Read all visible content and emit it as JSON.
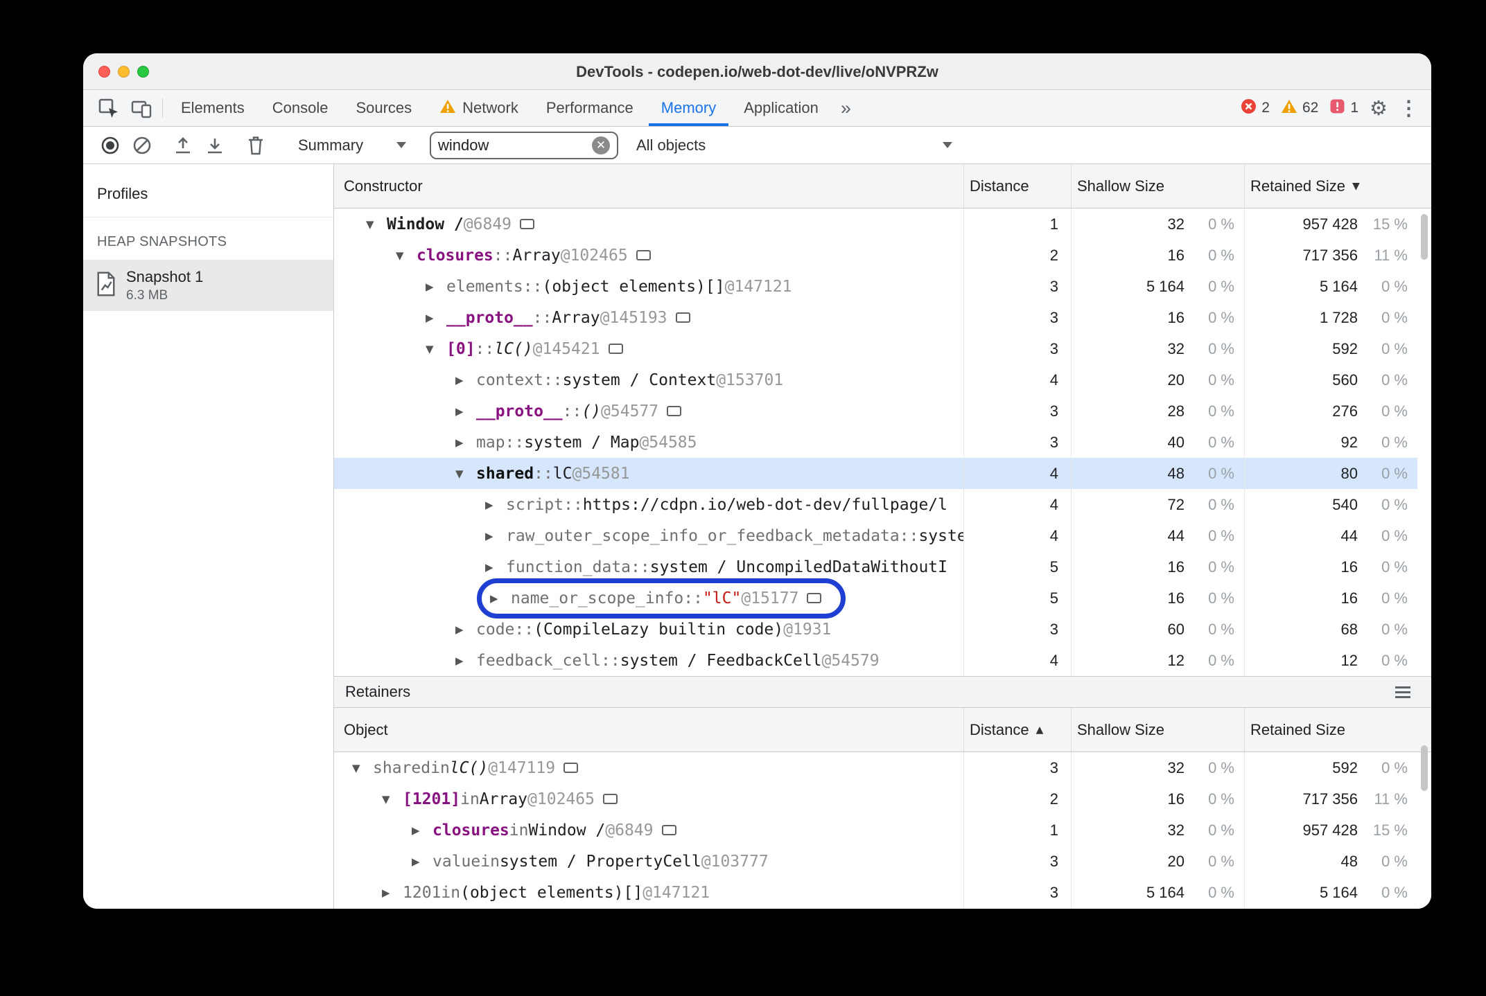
{
  "window": {
    "title": "DevTools - codepen.io/web-dot-dev/live/oNVPRZw"
  },
  "icons": {
    "gear": "⚙",
    "kebab": "⋮",
    "more_tabs": "»"
  },
  "tab_bar": {
    "tabs": [
      {
        "label": "Elements"
      },
      {
        "label": "Console"
      },
      {
        "label": "Sources"
      },
      {
        "label": "Network",
        "warning": true
      },
      {
        "label": "Performance"
      },
      {
        "label": "Memory",
        "selected": true
      },
      {
        "label": "Application"
      }
    ],
    "error_count": "2",
    "warning_count": "62",
    "issue_count": "1"
  },
  "toolbar": {
    "profile_view": "Summary",
    "search_value": "window",
    "class_filter": "All objects"
  },
  "sidebar": {
    "title": "Profiles",
    "section_label": "HEAP SNAPSHOTS",
    "snapshots": [
      {
        "name": "Snapshot 1",
        "size": "6.3 MB",
        "selected": true
      }
    ]
  },
  "constructor_pane": {
    "columns": {
      "object": "Constructor",
      "distance": "Distance",
      "shallow": "Shallow Size",
      "retained": "Retained Size"
    },
    "sort": {
      "column": "retained",
      "indicator": "▼"
    },
    "rows": [
      {
        "arrow": "down",
        "level": 0,
        "icon": true,
        "segs": [
          {
            "t": "Window /",
            "c": "obj"
          },
          {
            "t": " @6849",
            "c": "id"
          }
        ],
        "distance": "1",
        "shallow": "32",
        "shallow_pct": "0 %",
        "retained": "957 428",
        "retained_pct": "15 %"
      },
      {
        "arrow": "down",
        "level": 1,
        "icon": true,
        "segs": [
          {
            "t": "closures",
            "c": "prop"
          },
          {
            "t": " :: ",
            "c": "sep"
          },
          {
            "t": "Array",
            "c": "val"
          },
          {
            "t": " @102465",
            "c": "id"
          }
        ],
        "distance": "2",
        "shallow": "16",
        "shallow_pct": "0 %",
        "retained": "717 356",
        "retained_pct": "11 %"
      },
      {
        "arrow": "right",
        "level": 2,
        "icon": false,
        "segs": [
          {
            "t": "elements",
            "c": "int"
          },
          {
            "t": " :: ",
            "c": "sep"
          },
          {
            "t": "(object elements)[]",
            "c": "val"
          },
          {
            "t": " @147121",
            "c": "id"
          }
        ],
        "distance": "3",
        "shallow": "5 164",
        "shallow_pct": "0 %",
        "retained": "5 164",
        "retained_pct": "0 %"
      },
      {
        "arrow": "right",
        "level": 2,
        "icon": true,
        "segs": [
          {
            "t": "__proto__",
            "c": "prop"
          },
          {
            "t": " :: ",
            "c": "sep"
          },
          {
            "t": "Array",
            "c": "val"
          },
          {
            "t": " @145193",
            "c": "id"
          }
        ],
        "distance": "3",
        "shallow": "16",
        "shallow_pct": "0 %",
        "retained": "1 728",
        "retained_pct": "0 %"
      },
      {
        "arrow": "down",
        "level": 2,
        "icon": true,
        "segs": [
          {
            "t": "[0]",
            "c": "prop"
          },
          {
            "t": " :: ",
            "c": "sep"
          },
          {
            "t": "lC()",
            "c": "fn"
          },
          {
            "t": " @145421",
            "c": "id"
          }
        ],
        "distance": "3",
        "shallow": "32",
        "shallow_pct": "0 %",
        "retained": "592",
        "retained_pct": "0 %"
      },
      {
        "arrow": "right",
        "level": 3,
        "icon": false,
        "segs": [
          {
            "t": "context",
            "c": "int"
          },
          {
            "t": " :: ",
            "c": "sep"
          },
          {
            "t": "system / Context",
            "c": "val"
          },
          {
            "t": " @153701",
            "c": "id"
          }
        ],
        "distance": "4",
        "shallow": "20",
        "shallow_pct": "0 %",
        "retained": "560",
        "retained_pct": "0 %"
      },
      {
        "arrow": "right",
        "level": 3,
        "icon": true,
        "segs": [
          {
            "t": "__proto__",
            "c": "prop"
          },
          {
            "t": " :: ",
            "c": "sep"
          },
          {
            "t": "()",
            "c": "fn"
          },
          {
            "t": " @54577",
            "c": "id"
          }
        ],
        "distance": "3",
        "shallow": "28",
        "shallow_pct": "0 %",
        "retained": "276",
        "retained_pct": "0 %"
      },
      {
        "arrow": "right",
        "level": 3,
        "icon": false,
        "segs": [
          {
            "t": "map",
            "c": "int"
          },
          {
            "t": " :: ",
            "c": "sep"
          },
          {
            "t": "system / Map",
            "c": "val"
          },
          {
            "t": " @54585",
            "c": "id"
          }
        ],
        "distance": "3",
        "shallow": "40",
        "shallow_pct": "0 %",
        "retained": "92",
        "retained_pct": "0 %"
      },
      {
        "arrow": "down",
        "level": 3,
        "icon": false,
        "selected": true,
        "segs": [
          {
            "t": "shared",
            "c": "sel"
          },
          {
            "t": " :: ",
            "c": "sep"
          },
          {
            "t": "lC",
            "c": "val"
          },
          {
            "t": " @54581",
            "c": "id"
          }
        ],
        "distance": "4",
        "shallow": "48",
        "shallow_pct": "0 %",
        "retained": "80",
        "retained_pct": "0 %"
      },
      {
        "arrow": "right",
        "level": 4,
        "icon": false,
        "segs": [
          {
            "t": "script",
            "c": "int"
          },
          {
            "t": " :: ",
            "c": "sep"
          },
          {
            "t": "https://cdpn.io/web-dot-dev/fullpage/l",
            "c": "val"
          }
        ],
        "distance": "4",
        "shallow": "72",
        "shallow_pct": "0 %",
        "retained": "540",
        "retained_pct": "0 %"
      },
      {
        "arrow": "right",
        "level": 4,
        "icon": false,
        "segs": [
          {
            "t": "raw_outer_scope_info_or_feedback_metadata",
            "c": "int"
          },
          {
            "t": " :: ",
            "c": "sep"
          },
          {
            "t": "system",
            "c": "val"
          }
        ],
        "distance": "4",
        "shallow": "44",
        "shallow_pct": "0 %",
        "retained": "44",
        "retained_pct": "0 %"
      },
      {
        "arrow": "right",
        "level": 4,
        "icon": false,
        "segs": [
          {
            "t": "function_data",
            "c": "int"
          },
          {
            "t": " :: ",
            "c": "sep"
          },
          {
            "t": "system / UncompiledDataWithoutI",
            "c": "val"
          }
        ],
        "distance": "5",
        "shallow": "16",
        "shallow_pct": "0 %",
        "retained": "16",
        "retained_pct": "0 %"
      },
      {
        "arrow": "right",
        "level": 4,
        "icon": true,
        "highlight": true,
        "segs": [
          {
            "t": "name_or_scope_info",
            "c": "int"
          },
          {
            "t": " :: ",
            "c": "sep"
          },
          {
            "t": "\"lC\"",
            "c": "str"
          },
          {
            "t": " @15177",
            "c": "id"
          }
        ],
        "distance": "5",
        "shallow": "16",
        "shallow_pct": "0 %",
        "retained": "16",
        "retained_pct": "0 %"
      },
      {
        "arrow": "right",
        "level": 3,
        "icon": false,
        "segs": [
          {
            "t": "code",
            "c": "int"
          },
          {
            "t": " :: ",
            "c": "sep"
          },
          {
            "t": "(CompileLazy builtin code)",
            "c": "val"
          },
          {
            "t": " @1931",
            "c": "id"
          }
        ],
        "distance": "3",
        "shallow": "60",
        "shallow_pct": "0 %",
        "retained": "68",
        "retained_pct": "0 %"
      },
      {
        "arrow": "right",
        "level": 3,
        "icon": false,
        "segs": [
          {
            "t": "feedback_cell",
            "c": "int"
          },
          {
            "t": " :: ",
            "c": "sep"
          },
          {
            "t": "system / FeedbackCell",
            "c": "val"
          },
          {
            "t": " @54579",
            "c": "id"
          }
        ],
        "distance": "4",
        "shallow": "12",
        "shallow_pct": "0 %",
        "retained": "12",
        "retained_pct": "0 %"
      }
    ]
  },
  "retainers_pane": {
    "title": "Retainers",
    "columns": {
      "object": "Object",
      "distance": "Distance",
      "shallow": "Shallow Size",
      "retained": "Retained Size"
    },
    "sort": {
      "column": "distance",
      "indicator": "▲"
    },
    "rows": [
      {
        "arrow": "down",
        "level": 0,
        "icon": true,
        "segs": [
          {
            "t": "shared",
            "c": "int"
          },
          {
            "t": " in ",
            "c": "sep"
          },
          {
            "t": "lC()",
            "c": "fn"
          },
          {
            "t": " @147119",
            "c": "id"
          }
        ],
        "distance": "3",
        "shallow": "32",
        "shallow_pct": "0 %",
        "retained": "592",
        "retained_pct": "0 %"
      },
      {
        "arrow": "down",
        "level": 1,
        "icon": true,
        "segs": [
          {
            "t": "[1201]",
            "c": "prop"
          },
          {
            "t": " in ",
            "c": "sep"
          },
          {
            "t": "Array",
            "c": "val"
          },
          {
            "t": " @102465",
            "c": "id"
          }
        ],
        "distance": "2",
        "shallow": "16",
        "shallow_pct": "0 %",
        "retained": "717 356",
        "retained_pct": "11 %"
      },
      {
        "arrow": "right",
        "level": 2,
        "icon": true,
        "segs": [
          {
            "t": "closures",
            "c": "prop"
          },
          {
            "t": " in ",
            "c": "sep"
          },
          {
            "t": "Window /",
            "c": "val"
          },
          {
            "t": " @6849",
            "c": "id"
          }
        ],
        "distance": "1",
        "shallow": "32",
        "shallow_pct": "0 %",
        "retained": "957 428",
        "retained_pct": "15 %"
      },
      {
        "arrow": "right",
        "level": 2,
        "icon": false,
        "segs": [
          {
            "t": "value",
            "c": "int"
          },
          {
            "t": " in ",
            "c": "sep"
          },
          {
            "t": "system / PropertyCell",
            "c": "val"
          },
          {
            "t": " @103777",
            "c": "id"
          }
        ],
        "distance": "3",
        "shallow": "20",
        "shallow_pct": "0 %",
        "retained": "48",
        "retained_pct": "0 %"
      },
      {
        "arrow": "right",
        "level": 1,
        "icon": false,
        "segs": [
          {
            "t": "1201",
            "c": "int"
          },
          {
            "t": " in ",
            "c": "sep"
          },
          {
            "t": "(object elements)[]",
            "c": "val"
          },
          {
            "t": " @147121",
            "c": "id"
          }
        ],
        "distance": "3",
        "shallow": "5 164",
        "shallow_pct": "0 %",
        "retained": "5 164",
        "retained_pct": "0 %"
      }
    ]
  }
}
